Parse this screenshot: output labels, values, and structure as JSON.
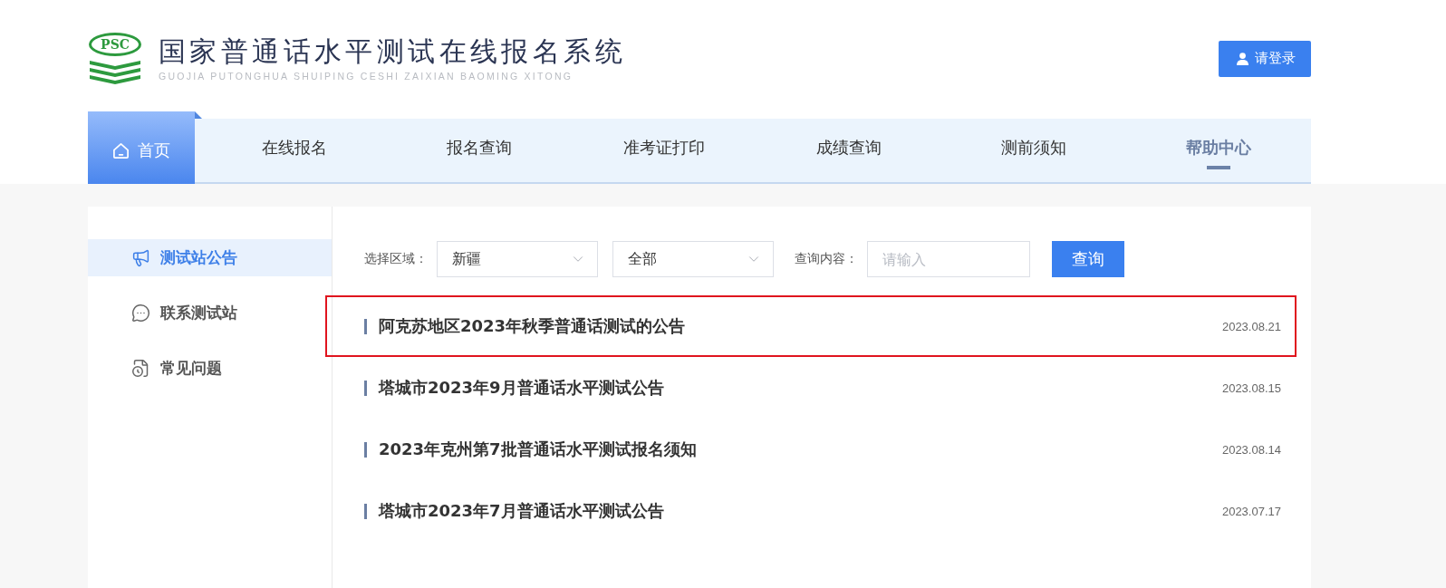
{
  "header": {
    "logo": {
      "mark": "PSC"
    },
    "title": "国家普通话水平测试在线报名系统",
    "subtitle": "GUOJIA PUTONGHUA SHUIPING CESHI ZAIXIAN BAOMING XITONG",
    "login_button": "请登录"
  },
  "nav": [
    {
      "label": "首页",
      "kind": "home",
      "selected": false
    },
    {
      "label": "在线报名",
      "kind": "link",
      "selected": false
    },
    {
      "label": "报名查询",
      "kind": "link",
      "selected": false
    },
    {
      "label": "准考证打印",
      "kind": "link",
      "selected": false
    },
    {
      "label": "成绩查询",
      "kind": "link",
      "selected": false
    },
    {
      "label": "测前须知",
      "kind": "link",
      "selected": false
    },
    {
      "label": "帮助中心",
      "kind": "link",
      "selected": true
    }
  ],
  "sidebar": {
    "items": [
      {
        "label": "测试站公告",
        "selected": true
      },
      {
        "label": "联系测试站",
        "selected": false
      },
      {
        "label": "常见问题",
        "selected": false
      }
    ]
  },
  "filters": {
    "region_label": "选择区域：",
    "region_select": {
      "value": "新疆"
    },
    "type_select": {
      "value": "全部"
    },
    "query_label": "查询内容：",
    "query_input": {
      "placeholder": "请输入"
    },
    "search_button": "查询"
  },
  "notices": [
    {
      "title": "阿克苏地区2023年秋季普通话测试的公告",
      "date": "2023.08.21",
      "outlined": true
    },
    {
      "title": "塔城市2023年9月普通话水平测试公告",
      "date": "2023.08.15",
      "outlined": false
    },
    {
      "title": "2023年克州第7批普通话水平测试报名须知",
      "date": "2023.08.14",
      "outlined": false
    },
    {
      "title": "塔城市2023年7月普通话水平测试公告",
      "date": "2023.07.17",
      "outlined": false
    }
  ]
}
